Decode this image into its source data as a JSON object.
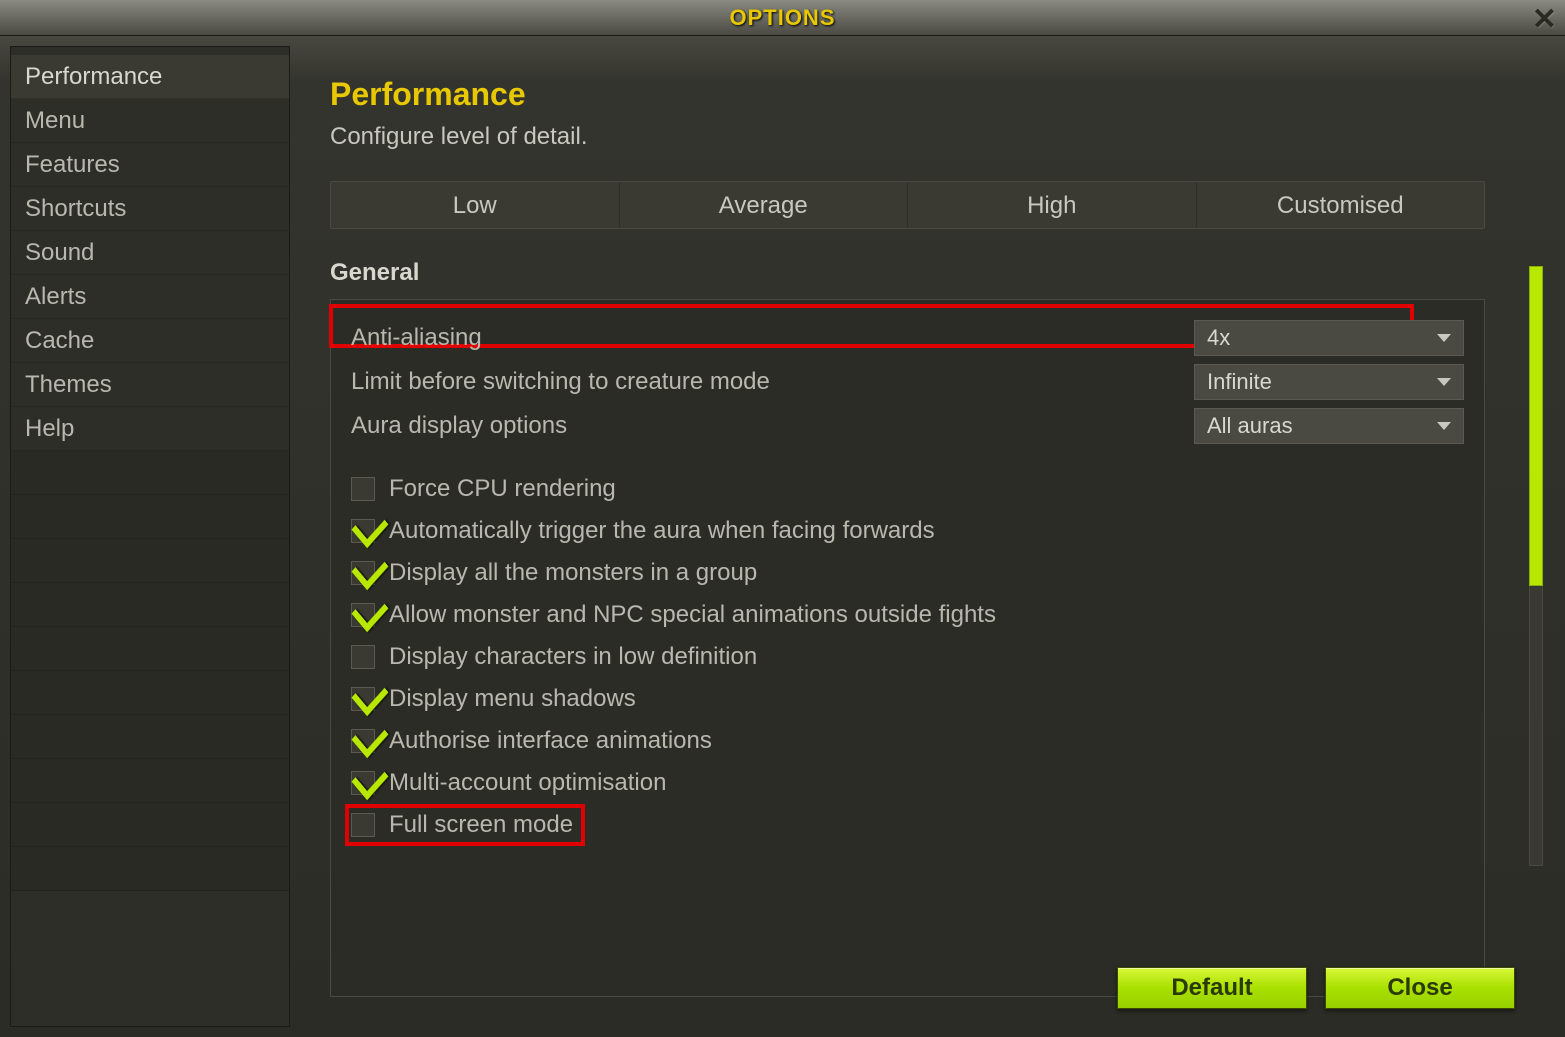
{
  "title": "OPTIONS",
  "sidebar": {
    "items": [
      {
        "label": "Performance"
      },
      {
        "label": "Menu"
      },
      {
        "label": "Features"
      },
      {
        "label": "Shortcuts"
      },
      {
        "label": "Sound"
      },
      {
        "label": "Alerts"
      },
      {
        "label": "Cache"
      },
      {
        "label": "Themes"
      },
      {
        "label": "Help"
      }
    ]
  },
  "page": {
    "title": "Performance",
    "subtitle": "Configure level of detail."
  },
  "presets": {
    "low": "Low",
    "average": "Average",
    "high": "High",
    "customised": "Customised"
  },
  "section": {
    "general": "General"
  },
  "options": {
    "antialiasing": {
      "label": "Anti-aliasing",
      "value": "4x"
    },
    "creature_limit": {
      "label": "Limit before switching to creature mode",
      "value": "Infinite"
    },
    "aura_display": {
      "label": "Aura display options",
      "value": "All auras"
    }
  },
  "checks": {
    "force_cpu": {
      "label": "Force CPU rendering",
      "checked": false
    },
    "auto_aura": {
      "label": "Automatically trigger the aura when facing forwards",
      "checked": true
    },
    "all_monsters": {
      "label": "Display all the monsters in a group",
      "checked": true
    },
    "npc_anim": {
      "label": "Allow monster and NPC special animations outside fights",
      "checked": true
    },
    "low_def": {
      "label": "Display characters in low definition",
      "checked": false
    },
    "menu_shadows": {
      "label": "Display menu shadows",
      "checked": true
    },
    "iface_anim": {
      "label": "Authorise interface animations",
      "checked": true
    },
    "multi_account": {
      "label": "Multi-account optimisation",
      "checked": true
    },
    "fullscreen": {
      "label": "Full screen mode",
      "checked": false
    }
  },
  "buttons": {
    "default": "Default",
    "close": "Close"
  }
}
